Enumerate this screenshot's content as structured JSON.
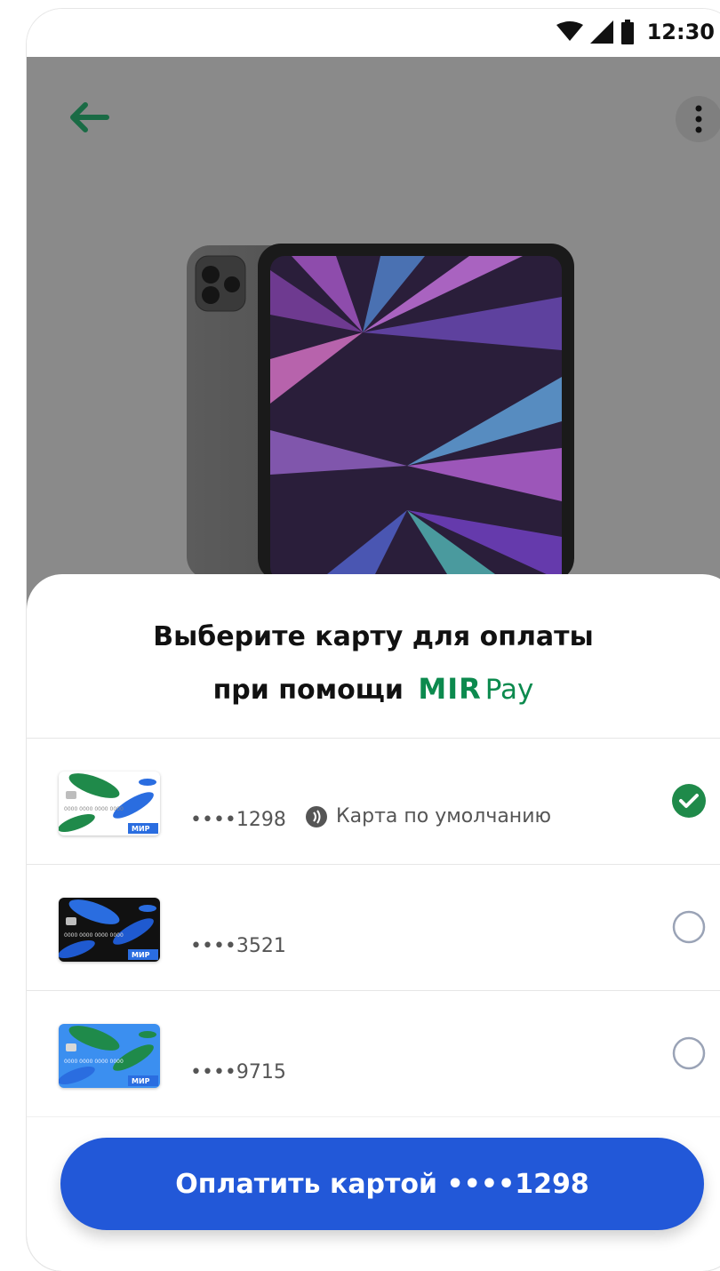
{
  "statusbar": {
    "time": "12:30"
  },
  "icons": {
    "back": "arrow-left-icon",
    "menu": "more-vertical-icon",
    "wifi": "wifi-icon",
    "signal": "signal-icon",
    "battery": "battery-icon",
    "contactless": "contactless-icon",
    "check": "check-icon"
  },
  "colors": {
    "accent": "#0c8a4e",
    "button": "#2258d8",
    "overlay": "#8a8a8a"
  },
  "sheet": {
    "title_line1": "Выберите карту для оплаты",
    "title_line2_prefix": "при помощи",
    "brand_mir": "MIR",
    "brand_pay": "Pay"
  },
  "cards": [
    {
      "number": "••••1298",
      "default_label": "Карта по умолчанию",
      "selected": true,
      "thumb_text": "0000 0000 0000 0000",
      "thumb_brand": "МИР"
    },
    {
      "number": "••••3521",
      "selected": false,
      "thumb_text": "0000 0000 0000 0000",
      "thumb_brand": "МИР"
    },
    {
      "number": "••••9715",
      "selected": false,
      "thumb_text": "0000 0000 0000 0000",
      "thumb_brand": "МИР"
    }
  ],
  "pay_button": {
    "label": "Оплатить картой ••••1298"
  }
}
